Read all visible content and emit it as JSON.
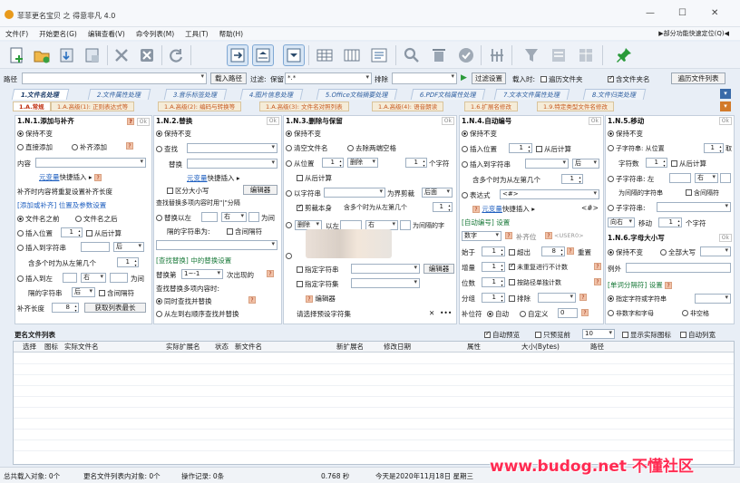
{
  "window": {
    "title": "菲菲更名宝贝 之 得意非凡 4.0",
    "min": "—",
    "max": "☐",
    "close": "✕"
  },
  "menu": [
    "文件(F)",
    "开始更名(G)",
    "编辑查看(V)",
    "命令列表(M)",
    "工具(T)",
    "帮助(H)"
  ],
  "menu_right": "▶部分功能快速定位(Q)◀",
  "toolbar_icons": [
    "new-file-icon",
    "open-folder-icon",
    "import-icon",
    "export-icon",
    "delete-icon",
    "clear-icon",
    "refresh-icon",
    "arrow-right-icon",
    "arrow-up-icon",
    "arrow-down-icon",
    "grid-view-icon",
    "column-view-icon",
    "detail-view-icon",
    "search-icon",
    "trash-icon",
    "check-icon",
    "sort-icon",
    "filter-icon",
    "form-icon",
    "table-icon",
    "pin-icon"
  ],
  "pathbar": {
    "path_label": "路径",
    "load_path_btn": "载入路径",
    "filter_label": "过滤:",
    "keep_label": "保留",
    "keep_value": "*.*",
    "exclude_label": "排除",
    "filter_settings_btn": "过滤设置",
    "load_when_label": "载入时:",
    "traverse_folder": "遍历文件夹",
    "include_folder_name": "含文件夹名",
    "traverse_list_btn": "遍历文件列表"
  },
  "tabs": [
    "1.文件名处理",
    "2.文件属性处理",
    "3.音乐标签处理",
    "4.图片信息处理",
    "5.Office文档摘要处理",
    "6.PDF文档属性处理",
    "7.文本文件属性处理",
    "8.文件归类处理"
  ],
  "subtabs": [
    "1.A.常规",
    "1.A.高级(1): 正则表达式等",
    "1.A.高级(2): 编码与转换等",
    "1.A.高级(3): 文件名对照列表",
    "1.A.高级(4): 语音朗读",
    "1.6.扩展名修改",
    "1.9.特定类型文件名修改"
  ],
  "panel_add": {
    "title": "1.N.1.添加与补齐",
    "ok": "Ok",
    "keep": "保持不变",
    "direct_add": "直接添加",
    "pad_add": "补齐添加",
    "content_label": "内容",
    "var_quick": "元变量",
    "var_quick2": "快捷插入 ▸",
    "note": "补齐时内容将重复设置补齐长度",
    "sub_title": "[添加或补齐] 位置及参数设置",
    "before_name": "文件名之前",
    "after_name": "文件名之后",
    "insert_pos": "插入位置",
    "insert_pos_val": "1",
    "from_after": "从后计算",
    "insert_to_str": "插入到字符串",
    "after_opt": "后",
    "contain_chars": "含多个时为从左第几个",
    "contain_val": "1",
    "insert_to": "插入到左",
    "right_opt": "右",
    "as_gap": "为间",
    "gap_chars": "隔的字符串",
    "after2": "后",
    "include_gap": "含间隔符",
    "pad_length": "补齐长度",
    "pad_val": "8",
    "get_list_btn": "获取列表最长"
  },
  "panel_replace": {
    "title": "1.N.2.替换",
    "ok": "Ok",
    "keep": "保持不变",
    "find": "查找",
    "replace": "替换",
    "var_quick": "元变量",
    "var_quick2": "快捷插入 ▸",
    "case": "区分大小写",
    "edit_btn": "编辑器",
    "multi_note": "查找替换多项内容时用\"|\"分隔",
    "replace_between": "替换以左",
    "right_opt": "右",
    "as_gap": "为间",
    "gap_chars": "隔的字符串为:",
    "include_gap": "含间隔符",
    "sub_title": "[查找替换] 中的替换设置",
    "replace_nth": "替换第",
    "nth_val": "1~-1",
    "occurrence": "次出现的",
    "multi_find": "查找替换多项内容时:",
    "simul": "同时查找并替换",
    "seq": "从左到右顺序查找并替换"
  },
  "panel_delete": {
    "title": "1.N.3.删除与保留",
    "ok": "Ok",
    "keep": "保持不变",
    "clear_name": "清空文件名",
    "remove_spaces": "去除两端空格",
    "from_pos": "从位置",
    "from_val": "1",
    "delete_opt": "删除",
    "count_val": "1",
    "chars": "个字符",
    "from_after": "从后计算",
    "by_str": "以字符串",
    "as_prefix": "为界剪裁",
    "after_opt": "后面",
    "cut_self": "剪裁本身",
    "contain_chars": "含多个时为从左第几个",
    "contain_val": "1",
    "delete_opt2": "删除",
    "left_opt": "以左",
    "right_opt": "右",
    "gap_label": "为间隔的字",
    "specify_chars": "指定字符串",
    "specify_set": "指定字符集",
    "editor_btn": "编辑器",
    "editor2_btn": "编辑器",
    "select_preset": "请选择预设字符集",
    "close_x": "✕",
    "more": "•••"
  },
  "panel_number": {
    "title": "1.N.4.自动编号",
    "ok": "Ok",
    "keep": "保持不变",
    "insert_pos": "插入位置",
    "insert_val": "1",
    "from_after": "从后计算",
    "insert_to_str": "插入到字符串",
    "after_opt": "后",
    "contain_chars": "含多个时为从左第几个",
    "contain_val": "1",
    "expr": "表达式",
    "expr_val": "<#>",
    "var_quick": "元变量",
    "var_quick2": "快捷插入 ▸",
    "expr_tag": "<#>",
    "sub_title": "[自动编号] 设置",
    "digit": "数字",
    "pre_zero": "补齐位",
    "user_tag": "<USER0>",
    "start": "始于",
    "start_val": "1",
    "overflow": "超出",
    "overflow_val": "8",
    "repeat": "重置",
    "step": "增量",
    "step_val": "1",
    "no_repeat": "未重复进行不计数",
    "digits": "位数",
    "digits_val": "1",
    "by_dir": "按路径单独计数",
    "group": "分组",
    "group_val": "1",
    "exclude": "排除",
    "pad_char": "补位符",
    "auto": "自动",
    "custom": "自定义",
    "custom_val": "0"
  },
  "panel_move": {
    "title": "1.N.5.移动",
    "ok": "Ok",
    "keep": "保持不变",
    "sub_from_pos": "子字符串: 从位置",
    "pos_val": "1",
    "take": "取",
    "char_count": "字符数",
    "count_val": "1",
    "from_after": "从后计算",
    "sub_left": "子字符串: 左",
    "right_opt": "右",
    "as_gap": "为间隔的字符串",
    "include_gap": "含间隔符",
    "sub_str": "子字符串:",
    "direction": "向右",
    "move": "移动",
    "move_val": "1",
    "chars": "个字符",
    "case_title": "1.N.6.字母大小写",
    "case_ok": "Ok",
    "case_keep": "保持不变",
    "all_upper": "全部大写",
    "exception": "例外",
    "sub_title": "[单词分隔符] 设置",
    "spec_word": "指定字符或字符串",
    "non_digit": "非数字和字母",
    "non_space": "非空格"
  },
  "list": {
    "title": "更名文件列表",
    "auto_preview": "自动预览",
    "only_preview": "只预览前",
    "preview_count": "10",
    "show_real_icon": "显示实际图标",
    "auto_list": "自动列宽",
    "columns": [
      "选择",
      "图标",
      "实际文件名",
      "实际扩展名",
      "状态",
      "新文件名",
      "新扩展名",
      "修改日期",
      "属性",
      "大小(Bytes)",
      "路径"
    ]
  },
  "status": {
    "loaded": "总共载入对象: 0个",
    "changed": "更名文件列表内对象: 0个",
    "ops": "操作记录: 0条",
    "time": "0.768 秒",
    "today": "今天是2020年11月18日 星期三"
  },
  "watermark": "www.budog.net 不懂社区"
}
